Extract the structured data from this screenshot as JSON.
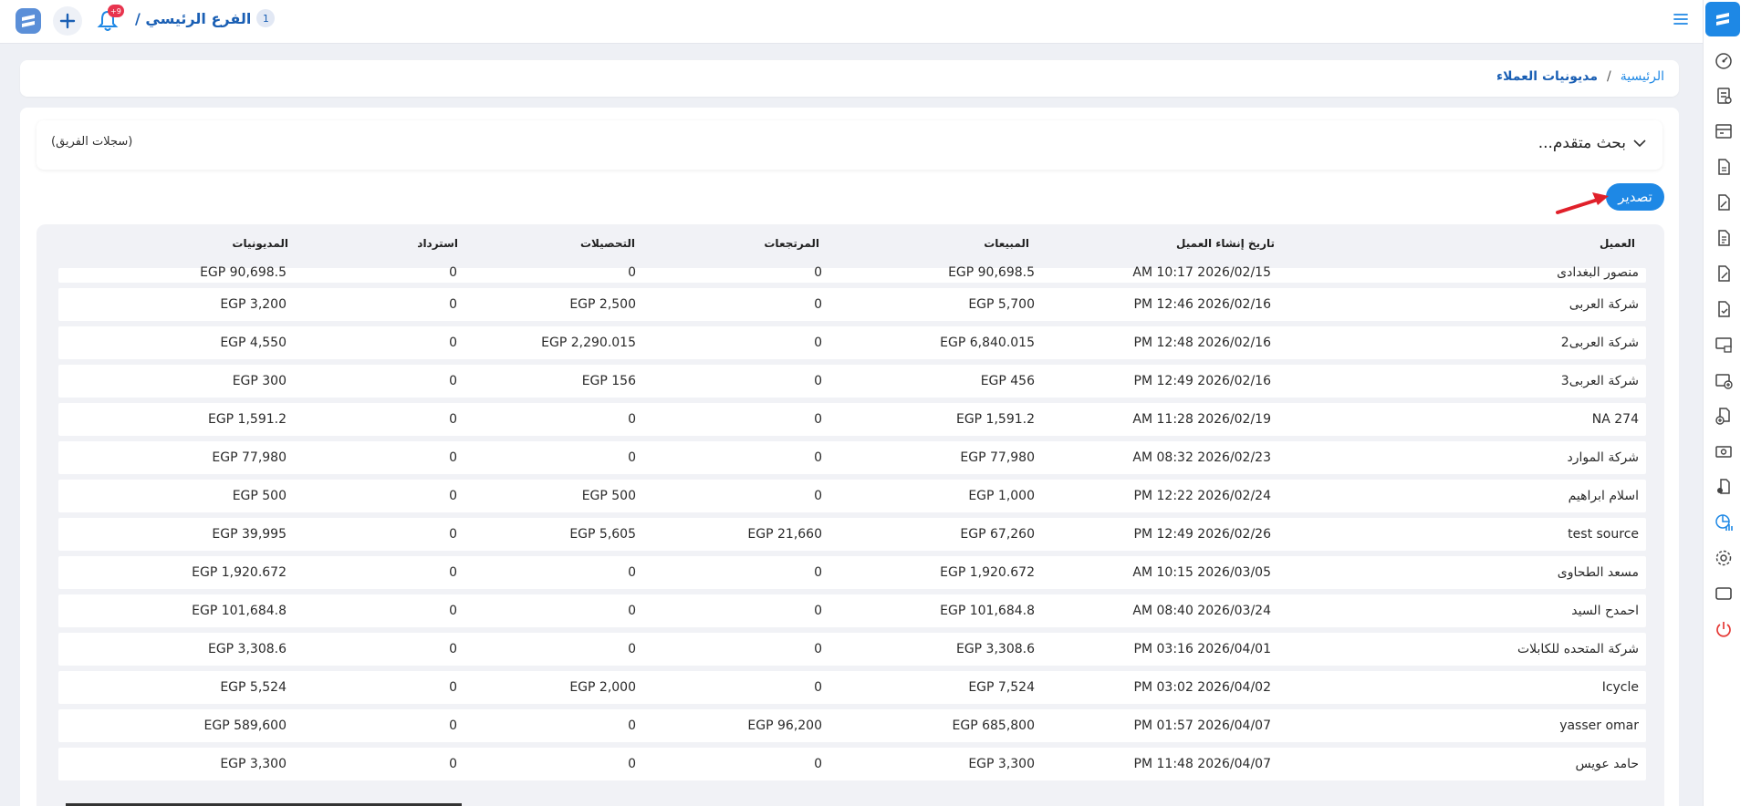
{
  "header": {
    "branch_number": "1",
    "branch_name": "الفرع الرئيسي /",
    "notification_count": "+9"
  },
  "breadcrumb": {
    "home": "الرئيسية",
    "separator": "/",
    "current": "مديونيات العملاء"
  },
  "search": {
    "title": "بحث متقدم...",
    "team_records": "(سجلات الفريق)"
  },
  "export_label": "تصدير",
  "colors": {
    "accent": "#1e88e5",
    "brand_dark": "#1a5fb4",
    "badge": "#e8344e",
    "arrow": "#e0202a"
  },
  "table": {
    "headers": {
      "name": "العميل",
      "date": "تاريخ إنشاء العميل",
      "sales": "المبيعات",
      "returns": "المرتجعات",
      "collections": "التحصيلات",
      "refund": "استرداد",
      "debts": "المديونيات"
    },
    "rows": [
      {
        "name": "منصور البغدادى",
        "date": "AM 10:17 2026/02/15",
        "sales": "EGP 90,698.5",
        "returns": "0",
        "collections": "0",
        "refund": "0",
        "debts": "EGP 90,698.5"
      },
      {
        "name": "شركة العربى",
        "date": "PM 12:46 2026/02/16",
        "sales": "EGP 5,700",
        "returns": "0",
        "collections": "EGP 2,500",
        "refund": "0",
        "debts": "EGP 3,200"
      },
      {
        "name": "شركة العربى2",
        "date": "PM 12:48 2026/02/16",
        "sales": "EGP 6,840.015",
        "returns": "0",
        "collections": "EGP 2,290.015",
        "refund": "0",
        "debts": "EGP 4,550"
      },
      {
        "name": "شركة العربى3",
        "date": "PM 12:49 2026/02/16",
        "sales": "EGP 456",
        "returns": "0",
        "collections": "EGP 156",
        "refund": "0",
        "debts": "EGP 300"
      },
      {
        "name": "NA 274",
        "date": "AM 11:28 2026/02/19",
        "sales": "EGP 1,591.2",
        "returns": "0",
        "collections": "0",
        "refund": "0",
        "debts": "EGP 1,591.2"
      },
      {
        "name": "شركة الموارد",
        "date": "AM 08:32 2026/02/23",
        "sales": "EGP 77,980",
        "returns": "0",
        "collections": "0",
        "refund": "0",
        "debts": "EGP 77,980"
      },
      {
        "name": "اسلام ابراهيم",
        "date": "PM 12:22 2026/02/24",
        "sales": "EGP 1,000",
        "returns": "0",
        "collections": "EGP 500",
        "refund": "0",
        "debts": "EGP 500"
      },
      {
        "name": "test source",
        "date": "PM 12:49 2026/02/26",
        "sales": "EGP 67,260",
        "returns": "EGP 21,660",
        "collections": "EGP 5,605",
        "refund": "0",
        "debts": "EGP 39,995"
      },
      {
        "name": "مسعد الطحاوى",
        "date": "AM 10:15 2026/03/05",
        "sales": "EGP 1,920.672",
        "returns": "0",
        "collections": "0",
        "refund": "0",
        "debts": "EGP 1,920.672"
      },
      {
        "name": "احمدح السيد",
        "date": "AM 08:40 2026/03/24",
        "sales": "EGP 101,684.8",
        "returns": "0",
        "collections": "0",
        "refund": "0",
        "debts": "EGP 101,684.8"
      },
      {
        "name": "شركة المتحده للكابلات",
        "date": "PM 03:16 2026/04/01",
        "sales": "EGP 3,308.6",
        "returns": "0",
        "collections": "0",
        "refund": "0",
        "debts": "EGP 3,308.6"
      },
      {
        "name": "Icycle",
        "date": "PM 03:02 2026/04/02",
        "sales": "EGP 7,524",
        "returns": "0",
        "collections": "EGP 2,000",
        "refund": "0",
        "debts": "EGP 5,524"
      },
      {
        "name": "yasser omar",
        "date": "PM 01:57 2026/04/07",
        "sales": "EGP 685,800",
        "returns": "EGP 96,200",
        "collections": "0",
        "refund": "0",
        "debts": "EGP 589,600"
      },
      {
        "name": "حامد عويس",
        "date": "PM 11:48 2026/04/07",
        "sales": "EGP 3,300",
        "returns": "0",
        "collections": "0",
        "refund": "0",
        "debts": "EGP 3,300"
      }
    ]
  },
  "sidebar_icons": [
    "speedometer-icon",
    "receipt-icon",
    "register-icon",
    "document-icon",
    "document-edit-icon",
    "file-text-icon",
    "file-edit-icon",
    "file-check-icon",
    "pos-screen-icon",
    "add-photo-icon",
    "add-document-icon",
    "cash-icon",
    "user-document-icon",
    "report-chart-icon",
    "settings-icon",
    "tablet-icon",
    "power-icon"
  ]
}
